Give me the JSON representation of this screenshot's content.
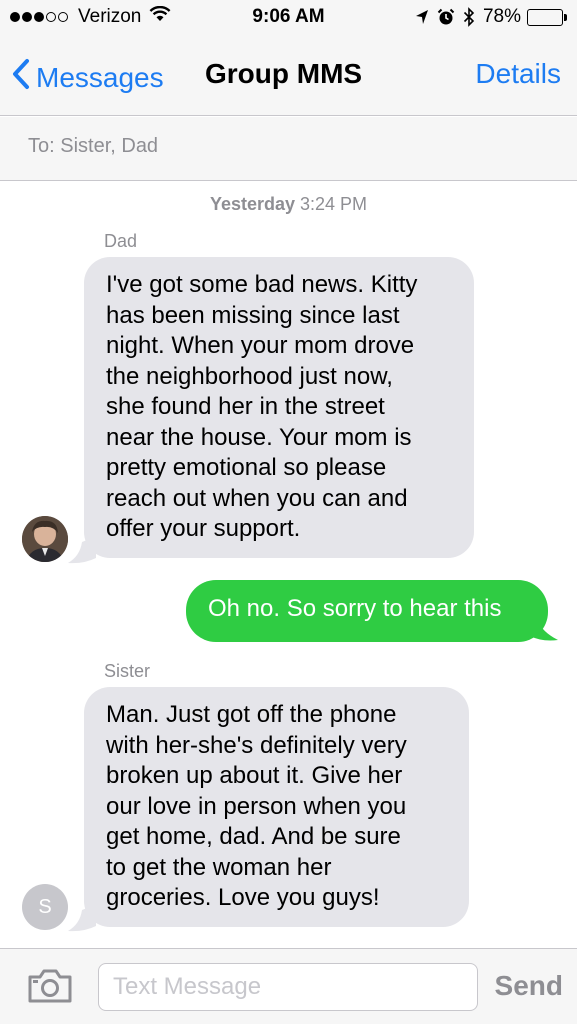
{
  "status_bar": {
    "carrier": "Verizon",
    "time": "9:06 AM",
    "battery_percent": "78%",
    "battery_level": 0.78,
    "icons": [
      "signal-dots-icon",
      "wifi-icon",
      "location-arrow-icon",
      "alarm-icon",
      "bluetooth-icon",
      "battery-icon"
    ]
  },
  "nav": {
    "back_label": "Messages",
    "title": "Group MMS",
    "details_label": "Details"
  },
  "recipients": {
    "text": "To: Sister, Dad"
  },
  "conversation": {
    "timestamp_day": "Yesterday",
    "timestamp_time": "3:24 PM",
    "messages": [
      {
        "sender": "Dad",
        "direction": "received",
        "lines": [
          "I've got some bad news. Kitty",
          "has been missing since last",
          "night. When your mom drove",
          "the neighborhood just now,",
          "she found her in the street",
          "near the house. Your mom is",
          "pretty emotional so please",
          "reach out when you can and",
          "offer your support."
        ]
      },
      {
        "sender": "",
        "direction": "sent",
        "lines": [
          "Oh no. So sorry to hear this"
        ]
      },
      {
        "sender": "Sister",
        "direction": "received",
        "avatar_initial": "S",
        "lines": [
          "Man. Just got off the phone",
          "with her-she's definitely very",
          "broken up about it. Give her",
          "our love in person when you",
          "get home, dad. And be sure",
          "to get the woman her",
          "groceries. Love you guys!"
        ]
      }
    ]
  },
  "composer": {
    "placeholder": "Text Message",
    "send_label": "Send"
  },
  "colors": {
    "ios_blue": "#1d7cf2",
    "received_bubble": "#e5e5ea",
    "sent_bubble": "#2fcc43",
    "secondary_text": "#8e8e93"
  }
}
